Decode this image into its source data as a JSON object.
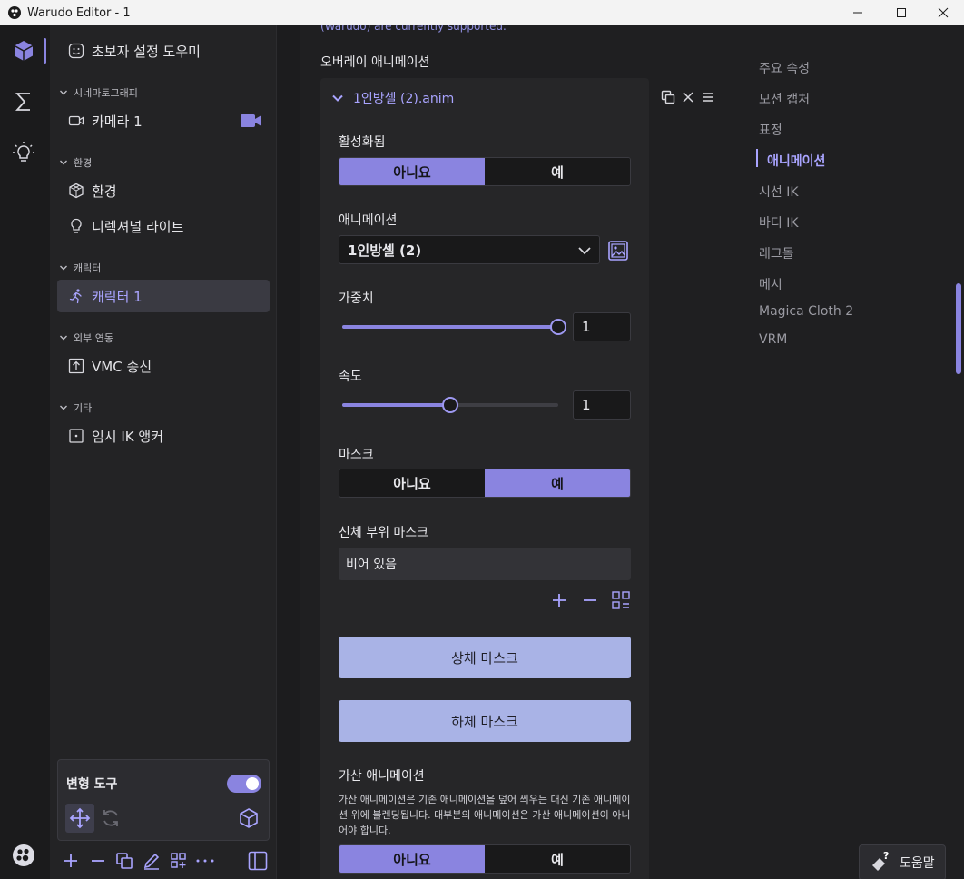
{
  "window": {
    "title": "Warudo Editor - 1"
  },
  "rail": {
    "icons": [
      "cube-icon",
      "sigma-icon",
      "lightbulb-icon",
      "warudo-logo-icon"
    ]
  },
  "sidebar": {
    "wizard": "초보자 설정 도우미",
    "sections": [
      {
        "label": "시네마토그래피",
        "items": [
          {
            "label": "카메라 1",
            "icon": "video-icon"
          }
        ]
      },
      {
        "label": "환경",
        "items": [
          {
            "label": "환경",
            "icon": "environment-icon"
          },
          {
            "label": "디렉셔널 라이트",
            "icon": "lightbulb-icon"
          }
        ]
      },
      {
        "label": "캐릭터",
        "items": [
          {
            "label": "캐릭터 1",
            "icon": "running-figure-icon",
            "active": true
          }
        ]
      },
      {
        "label": "외부 연동",
        "items": [
          {
            "label": "VMC 송신",
            "icon": "upload-icon"
          }
        ]
      },
      {
        "label": "기타",
        "items": [
          {
            "label": "임시 IK 앵커",
            "icon": "anchor-icon"
          }
        ]
      }
    ],
    "tool_panel": {
      "title": "변형 도구",
      "enabled": true
    }
  },
  "center": {
    "supported_note": "(Warudo) are currently supported.",
    "section_title": "오버레이 애니메이션",
    "card": {
      "header": "1인방셀 (2).anim",
      "enabled_label": "활성화됨",
      "no": "아니요",
      "yes": "예",
      "animation_label": "애니메이션",
      "animation_value": "1인방셀 (2)",
      "weight_label": "가중치",
      "weight_value": "1",
      "weight_fraction": 1.0,
      "speed_label": "속도",
      "speed_value": "1",
      "speed_fraction": 0.5,
      "mask_label": "마스크",
      "body_mask_label": "신체 부위 마스크",
      "body_mask_value": "비어 있음",
      "upper_mask": "상체 마스크",
      "lower_mask": "하체 마스크",
      "additive_label": "가산 애니메이션",
      "additive_desc": "가산 애니메이션은 기존 애니메이션을 덮어 씌우는 대신 기존 애니메이션 위에 블렌딩됩니다. 대부분의 애니메이션은 가산 애니메이션이 아니어야 합니다."
    }
  },
  "nav": {
    "items": [
      "주요 속성",
      "모션 캡처",
      "표정",
      "애니메이션",
      "시선 IK",
      "바디 IK",
      "래그돌",
      "메시",
      "Magica Cloth 2",
      "VRM"
    ],
    "active_index": 3
  },
  "help": {
    "label": "도움말"
  },
  "colors": {
    "accent": "#8a84e0",
    "accent_text": "#a9a4ff",
    "mask_button": "#a9b3e6"
  }
}
